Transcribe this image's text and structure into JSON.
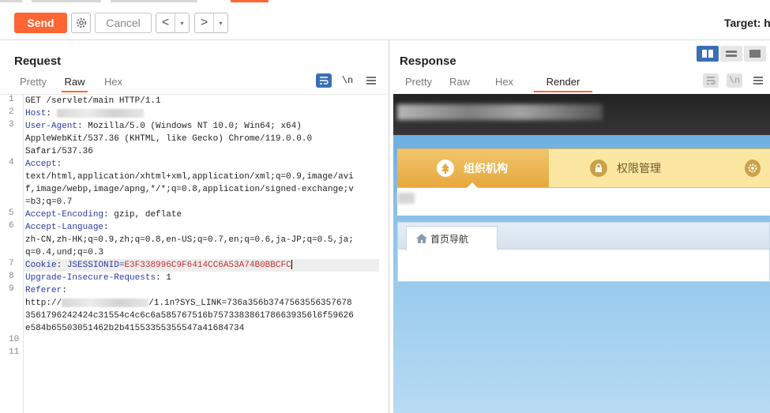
{
  "toolbar": {
    "send_label": "Send",
    "cancel_label": "Cancel",
    "prev_label": "<",
    "next_label": ">",
    "dropdown_glyph": "▾",
    "target_label": "Target: h"
  },
  "request": {
    "title": "Request",
    "tabs": [
      "Pretty",
      "Raw",
      "Hex"
    ],
    "active_tab": "Raw",
    "tools": [
      "wrap-icon",
      "newline-toggle",
      "menu-icon"
    ],
    "newline_label": "\\n",
    "lines": [
      {
        "n": "1",
        "text": "GET /servlet/main HTTP/1.1"
      },
      {
        "n": "2",
        "name": "Host",
        "value": ""
      },
      {
        "n": "3",
        "name": "User-Agent",
        "value": "Mozilla/5.0 (Windows NT 10.0; Win64; x64)"
      },
      {
        "n": "",
        "text": "AppleWebKit/537.36 (KHTML, like Gecko) Chrome/119.0.0.0"
      },
      {
        "n": "",
        "text": "Safari/537.36"
      },
      {
        "n": "4",
        "name": "Accept",
        "value": ""
      },
      {
        "n": "",
        "text": "text/html,application/xhtml+xml,application/xml;q=0.9,image/avi"
      },
      {
        "n": "",
        "text": "f,image/webp,image/apng,*/*;q=0.8,application/signed-exchange;v"
      },
      {
        "n": "",
        "text": "=b3;q=0.7"
      },
      {
        "n": "5",
        "name": "Accept-Encoding",
        "value": "gzip, deflate"
      },
      {
        "n": "6",
        "name": "Accept-Language",
        "value": ""
      },
      {
        "n": "",
        "text": "zh-CN,zh-HK;q=0.9,zh;q=0.8,en-US;q=0.7,en;q=0.6,ja-JP;q=0.5,ja;"
      },
      {
        "n": "",
        "text": "q=0.4,und;q=0.3"
      },
      {
        "n": "7",
        "name": "Cookie",
        "value": "JSESSIONID=",
        "highlight": "E3F338996C9F6414CC6A53A74B0BBCFC"
      },
      {
        "n": "8",
        "name": "Upgrade-Insecure-Requests",
        "value": "1"
      },
      {
        "n": "9",
        "name": "Referer",
        "value": ""
      },
      {
        "n": "",
        "text_prefix": "http://",
        "text_suffix": "/1.1n?SYS_LINK=736a356b3747563556357678"
      },
      {
        "n": "",
        "text": "3561796242424c31554c4c6c6a585767516b7573383861786639356l6f59626"
      },
      {
        "n": "",
        "text": "e584b65503051462b2b41553355355547a41684734"
      },
      {
        "n": "10",
        "text": ""
      },
      {
        "n": "11",
        "text": ""
      }
    ]
  },
  "response": {
    "title": "Response",
    "tabs": [
      "Pretty",
      "Raw",
      "Hex",
      "Render"
    ],
    "active_tab": "Render",
    "newline_label": "\\n",
    "render": {
      "menu": [
        {
          "label": "组织机构",
          "icon": "tree-icon",
          "active": true
        },
        {
          "label": "权限管理",
          "icon": "lock-icon",
          "active": false
        },
        {
          "label": "",
          "icon": "gear-icon",
          "active": false
        }
      ],
      "panel_tab": "首页导航"
    }
  },
  "colors": {
    "accent": "#ff6633",
    "header_name": "#2d3aa0",
    "cookie_value": "#c53030",
    "layout_active": "#3a6fb5"
  }
}
